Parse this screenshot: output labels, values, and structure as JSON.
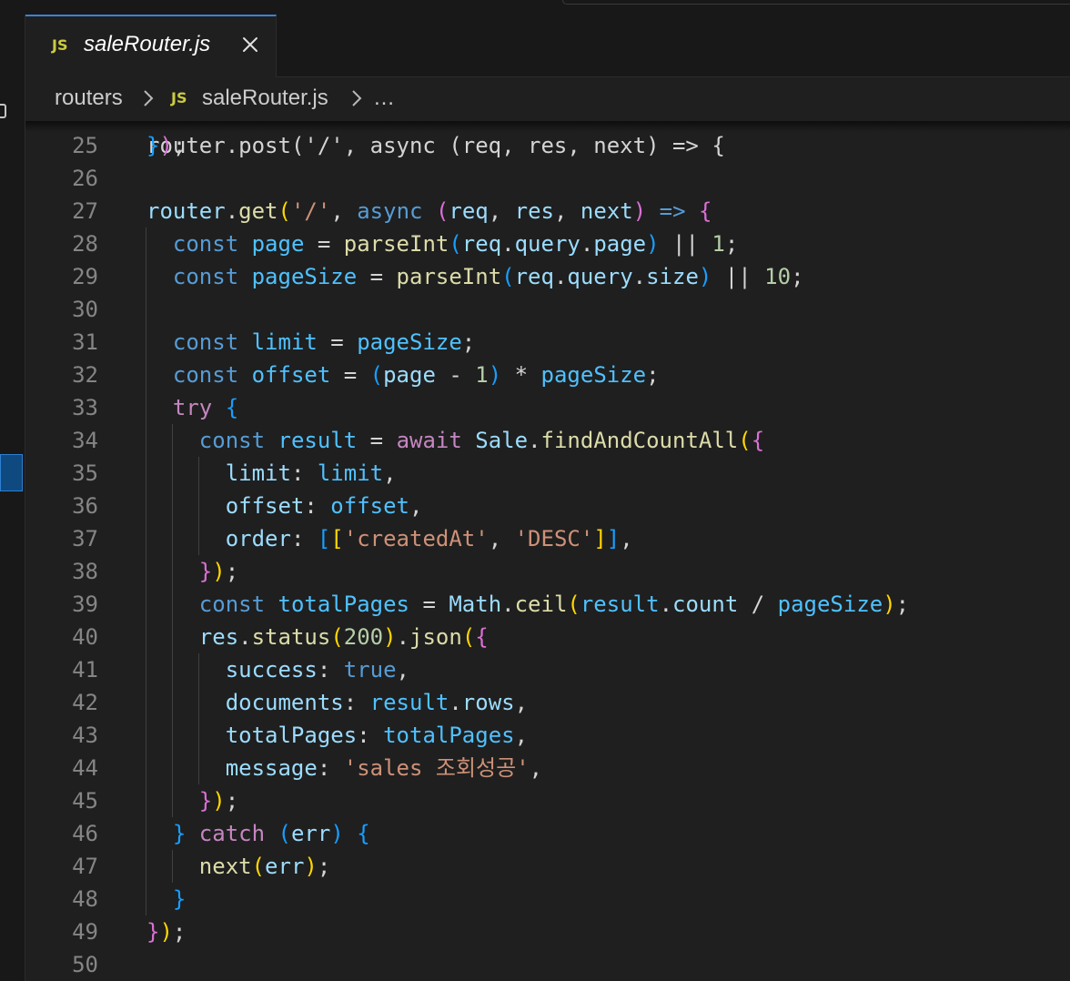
{
  "tab": {
    "icon": "JS",
    "filename": "saleRouter.js",
    "close_icon": "close-icon"
  },
  "breadcrumb": {
    "folder": "routers",
    "file_icon": "JS",
    "file": "saleRouter.js",
    "more": "…"
  },
  "colors": {
    "keyword": "#569cd6",
    "control": "#c586c0",
    "variable": "#9cdcfe",
    "constant": "#4fc1ff",
    "function": "#dcdcaa",
    "string": "#ce9178",
    "number": "#b5cea8",
    "bracket_gold": "#ffd700",
    "bracket_orchid": "#da70d6",
    "bracket_blue": "#179fff",
    "tab_accent": "#3b82d6"
  },
  "editor": {
    "partial_top_line": "router.post('/', async (req, res, next) => {",
    "lines": [
      {
        "n": "25",
        "indent": 0,
        "tokens": [
          [
            "p3",
            "}"
          ],
          [
            "p2",
            ")"
          ],
          [
            "plain",
            ";"
          ]
        ]
      },
      {
        "n": "26",
        "indent": 0,
        "tokens": []
      },
      {
        "n": "27",
        "indent": 0,
        "tokens": [
          [
            "var",
            "router"
          ],
          [
            "plain",
            "."
          ],
          [
            "fn",
            "get"
          ],
          [
            "p1",
            "("
          ],
          [
            "str",
            "'/'"
          ],
          [
            "plain",
            ", "
          ],
          [
            "kw",
            "async"
          ],
          [
            "plain",
            " "
          ],
          [
            "p2",
            "("
          ],
          [
            "var",
            "req"
          ],
          [
            "plain",
            ", "
          ],
          [
            "var",
            "res"
          ],
          [
            "plain",
            ", "
          ],
          [
            "var",
            "next"
          ],
          [
            "p2",
            ")"
          ],
          [
            "plain",
            " "
          ],
          [
            "kw",
            "=>"
          ],
          [
            "plain",
            " "
          ],
          [
            "p2",
            "{"
          ]
        ]
      },
      {
        "n": "28",
        "indent": 1,
        "tokens": [
          [
            "kw",
            "const"
          ],
          [
            "plain",
            " "
          ],
          [
            "cst",
            "page"
          ],
          [
            "plain",
            " = "
          ],
          [
            "fn",
            "parseInt"
          ],
          [
            "p3",
            "("
          ],
          [
            "var",
            "req"
          ],
          [
            "plain",
            "."
          ],
          [
            "var",
            "query"
          ],
          [
            "plain",
            "."
          ],
          [
            "var",
            "page"
          ],
          [
            "p3",
            ")"
          ],
          [
            "plain",
            " || "
          ],
          [
            "num",
            "1"
          ],
          [
            "plain",
            ";"
          ]
        ]
      },
      {
        "n": "29",
        "indent": 1,
        "tokens": [
          [
            "kw",
            "const"
          ],
          [
            "plain",
            " "
          ],
          [
            "cst",
            "pageSize"
          ],
          [
            "plain",
            " = "
          ],
          [
            "fn",
            "parseInt"
          ],
          [
            "p3",
            "("
          ],
          [
            "var",
            "req"
          ],
          [
            "plain",
            "."
          ],
          [
            "var",
            "query"
          ],
          [
            "plain",
            "."
          ],
          [
            "var",
            "size"
          ],
          [
            "p3",
            ")"
          ],
          [
            "plain",
            " || "
          ],
          [
            "num",
            "10"
          ],
          [
            "plain",
            ";"
          ]
        ]
      },
      {
        "n": "30",
        "indent": 1,
        "tokens": []
      },
      {
        "n": "31",
        "indent": 1,
        "tokens": [
          [
            "kw",
            "const"
          ],
          [
            "plain",
            " "
          ],
          [
            "cst",
            "limit"
          ],
          [
            "plain",
            " = "
          ],
          [
            "cst",
            "pageSize"
          ],
          [
            "plain",
            ";"
          ]
        ]
      },
      {
        "n": "32",
        "indent": 1,
        "tokens": [
          [
            "kw",
            "const"
          ],
          [
            "plain",
            " "
          ],
          [
            "cst",
            "offset"
          ],
          [
            "plain",
            " = "
          ],
          [
            "p3",
            "("
          ],
          [
            "var",
            "page"
          ],
          [
            "plain",
            " - "
          ],
          [
            "num",
            "1"
          ],
          [
            "p3",
            ")"
          ],
          [
            "plain",
            " * "
          ],
          [
            "cst",
            "pageSize"
          ],
          [
            "plain",
            ";"
          ]
        ]
      },
      {
        "n": "33",
        "indent": 1,
        "tokens": [
          [
            "ctl",
            "try"
          ],
          [
            "plain",
            " "
          ],
          [
            "p3",
            "{"
          ]
        ]
      },
      {
        "n": "34",
        "indent": 2,
        "tokens": [
          [
            "kw",
            "const"
          ],
          [
            "plain",
            " "
          ],
          [
            "cst",
            "result"
          ],
          [
            "plain",
            " = "
          ],
          [
            "ctl",
            "await"
          ],
          [
            "plain",
            " "
          ],
          [
            "var",
            "Sale"
          ],
          [
            "plain",
            "."
          ],
          [
            "fn",
            "findAndCountAll"
          ],
          [
            "p1",
            "("
          ],
          [
            "p2",
            "{"
          ]
        ]
      },
      {
        "n": "35",
        "indent": 3,
        "tokens": [
          [
            "prop",
            "limit"
          ],
          [
            "plain",
            ": "
          ],
          [
            "cst",
            "limit"
          ],
          [
            "plain",
            ","
          ]
        ]
      },
      {
        "n": "36",
        "indent": 3,
        "tokens": [
          [
            "prop",
            "offset"
          ],
          [
            "plain",
            ": "
          ],
          [
            "cst",
            "offset"
          ],
          [
            "plain",
            ","
          ]
        ]
      },
      {
        "n": "37",
        "indent": 3,
        "tokens": [
          [
            "prop",
            "order"
          ],
          [
            "plain",
            ": "
          ],
          [
            "p3",
            "["
          ],
          [
            "p1",
            "["
          ],
          [
            "str",
            "'createdAt'"
          ],
          [
            "plain",
            ", "
          ],
          [
            "str",
            "'DESC'"
          ],
          [
            "p1",
            "]"
          ],
          [
            "p3",
            "]"
          ],
          [
            "plain",
            ","
          ]
        ]
      },
      {
        "n": "38",
        "indent": 2,
        "tokens": [
          [
            "p2",
            "}"
          ],
          [
            "p1",
            ")"
          ],
          [
            "plain",
            ";"
          ]
        ]
      },
      {
        "n": "39",
        "indent": 2,
        "tokens": [
          [
            "kw",
            "const"
          ],
          [
            "plain",
            " "
          ],
          [
            "cst",
            "totalPages"
          ],
          [
            "plain",
            " = "
          ],
          [
            "var",
            "Math"
          ],
          [
            "plain",
            "."
          ],
          [
            "fn",
            "ceil"
          ],
          [
            "p1",
            "("
          ],
          [
            "cst",
            "result"
          ],
          [
            "plain",
            "."
          ],
          [
            "var",
            "count"
          ],
          [
            "plain",
            " / "
          ],
          [
            "cst",
            "pageSize"
          ],
          [
            "p1",
            ")"
          ],
          [
            "plain",
            ";"
          ]
        ]
      },
      {
        "n": "40",
        "indent": 2,
        "tokens": [
          [
            "var",
            "res"
          ],
          [
            "plain",
            "."
          ],
          [
            "fn",
            "status"
          ],
          [
            "p1",
            "("
          ],
          [
            "num",
            "200"
          ],
          [
            "p1",
            ")"
          ],
          [
            "plain",
            "."
          ],
          [
            "fn",
            "json"
          ],
          [
            "p1",
            "("
          ],
          [
            "p2",
            "{"
          ]
        ]
      },
      {
        "n": "41",
        "indent": 3,
        "tokens": [
          [
            "prop",
            "success"
          ],
          [
            "plain",
            ": "
          ],
          [
            "kw",
            "true"
          ],
          [
            "plain",
            ","
          ]
        ]
      },
      {
        "n": "42",
        "indent": 3,
        "tokens": [
          [
            "prop",
            "documents"
          ],
          [
            "plain",
            ": "
          ],
          [
            "cst",
            "result"
          ],
          [
            "plain",
            "."
          ],
          [
            "var",
            "rows"
          ],
          [
            "plain",
            ","
          ]
        ]
      },
      {
        "n": "43",
        "indent": 3,
        "tokens": [
          [
            "prop",
            "totalPages"
          ],
          [
            "plain",
            ": "
          ],
          [
            "cst",
            "totalPages"
          ],
          [
            "plain",
            ","
          ]
        ]
      },
      {
        "n": "44",
        "indent": 3,
        "tokens": [
          [
            "prop",
            "message"
          ],
          [
            "plain",
            ": "
          ],
          [
            "str",
            "'sales 조회성공'"
          ],
          [
            "plain",
            ","
          ]
        ]
      },
      {
        "n": "45",
        "indent": 2,
        "tokens": [
          [
            "p2",
            "}"
          ],
          [
            "p1",
            ")"
          ],
          [
            "plain",
            ";"
          ]
        ]
      },
      {
        "n": "46",
        "indent": 1,
        "tokens": [
          [
            "p3",
            "}"
          ],
          [
            "plain",
            " "
          ],
          [
            "ctl",
            "catch"
          ],
          [
            "plain",
            " "
          ],
          [
            "p3",
            "("
          ],
          [
            "var",
            "err"
          ],
          [
            "p3",
            ")"
          ],
          [
            "plain",
            " "
          ],
          [
            "p3",
            "{"
          ]
        ]
      },
      {
        "n": "47",
        "indent": 2,
        "tokens": [
          [
            "fn",
            "next"
          ],
          [
            "p1",
            "("
          ],
          [
            "var",
            "err"
          ],
          [
            "p1",
            ")"
          ],
          [
            "plain",
            ";"
          ]
        ]
      },
      {
        "n": "48",
        "indent": 1,
        "tokens": [
          [
            "p3",
            "}"
          ]
        ]
      },
      {
        "n": "49",
        "indent": 0,
        "tokens": [
          [
            "p2",
            "}"
          ],
          [
            "p1",
            ")"
          ],
          [
            "plain",
            ";"
          ]
        ]
      },
      {
        "n": "50",
        "indent": 0,
        "tokens": []
      }
    ]
  }
}
